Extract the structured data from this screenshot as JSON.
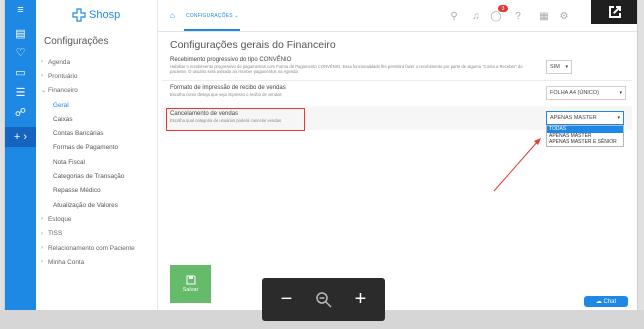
{
  "logo": {
    "text": "Shosp"
  },
  "sidebar": {
    "title": "Configurações",
    "items": [
      {
        "label": "Agenda",
        "chevron": "›",
        "expanded": false
      },
      {
        "label": "Prontuário",
        "chevron": "›",
        "expanded": false
      },
      {
        "label": "Financeiro",
        "chevron": "⌄",
        "expanded": true
      }
    ],
    "sub_items": [
      "Geral",
      "Caixas",
      "Contas Bancárias",
      "Formas de Pagamento",
      "Nota Fiscal",
      "Categorias de Transação",
      "Repasse Médico",
      "Atualização de Valores"
    ],
    "items_after": [
      {
        "label": "Estoque",
        "chevron": "›"
      },
      {
        "label": "TISS",
        "chevron": "›"
      },
      {
        "label": "Relacionamento com Paciente",
        "chevron": "›"
      },
      {
        "label": "Minha Conta",
        "chevron": "›"
      }
    ]
  },
  "header": {
    "breadcrumb": "CONFIGURAÇÕES",
    "breadcrumb_chevron": "⌄",
    "notification_count": "3"
  },
  "main": {
    "title": "Configurações gerais do Financeiro",
    "settings": [
      {
        "label": "Recebimento progressivo do tipo CONVÊNIO",
        "description": "Habilitar o recebimento progressivo de pagamentos com Forma de Pagamento CONVÊNIO. Essa funcionalidade lhe permitirá fazer o recebimento por parte de alguma \"Conta a Receber\" do paciente. O usuário será avisado ao receber pagamentos na Agenda",
        "value": "SIM"
      },
      {
        "label": "Formato de impressão de recibo de vendas",
        "description": "Escolha como deseja que seja impresso o recibo de vendas",
        "value": "FOLHA A4 (ÚNICO)"
      },
      {
        "label": "Cancelamento de vendas",
        "description": "Escolha qual categoria de usuários poderá cancelar vendas",
        "value": "APENAS MASTER"
      }
    ],
    "dropdown_options": [
      "TODAS",
      "APENAS MASTER",
      "APENAS MASTER E SÊNIOR"
    ],
    "save_label": "Salvar",
    "chat_label": "Chat"
  },
  "zoom": {
    "minus": "−",
    "zoom_out": "⚲",
    "plus": "+"
  },
  "colors": {
    "primary": "#1e88e5",
    "save": "#66bb6a",
    "highlight": "#e53935"
  }
}
